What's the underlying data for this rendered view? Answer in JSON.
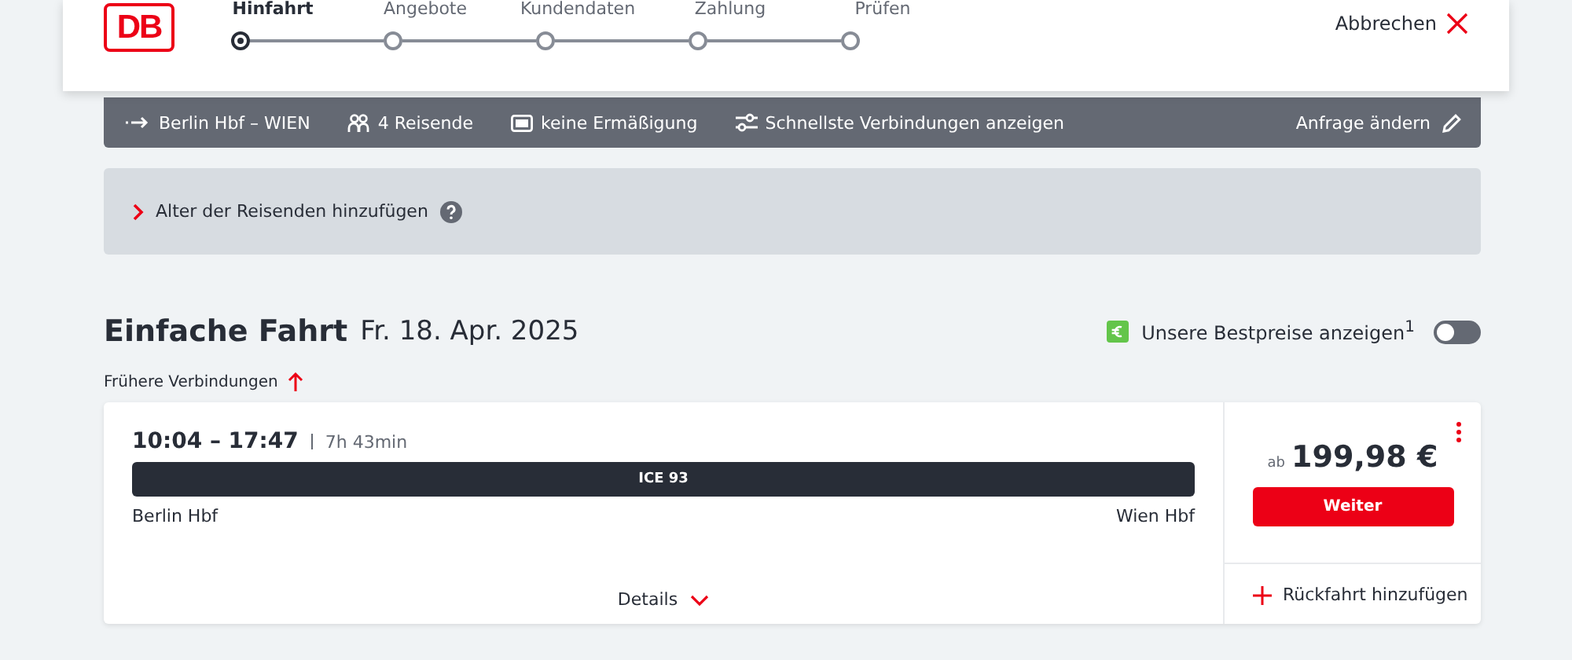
{
  "header": {
    "logo": "DB",
    "cancel": "Abbrechen"
  },
  "steps": [
    {
      "label": "Hinfahrt",
      "selected": true
    },
    {
      "label": "Angebote",
      "selected": false
    },
    {
      "label": "Kundendaten",
      "selected": false
    },
    {
      "label": "Zahlung",
      "selected": false
    },
    {
      "label": "Prüfen",
      "selected": false
    }
  ],
  "summary": {
    "items": [
      {
        "kind": "route",
        "label": "Berlin Hbf – WIEN"
      },
      {
        "kind": "travellers",
        "label": "4 Reisende"
      },
      {
        "kind": "discount",
        "label": "keine Ermäßigung"
      },
      {
        "kind": "filter",
        "label": "Schnellste Verbindungen anzeigen"
      }
    ],
    "edit": "Anfrage ändern"
  },
  "age_panel": {
    "label": "Alter der Reisenden hinzufügen",
    "expanded": false
  },
  "heading": {
    "title": "Einfache Fahrt",
    "date": "Fr. 18. Apr. 2025"
  },
  "best_price": {
    "label": "Unsere Bestpreise anzeigen$^{1}$",
    "on": false
  },
  "earlier": "Frühere Verbindungen",
  "connection": {
    "times": "10:04 – 17:47",
    "duration": "7h 43min",
    "train": "ICE 93",
    "from": "Berlin Hbf",
    "to": "Wien Hbf",
    "details": "Details",
    "price_prefix": "ab",
    "price": "199,98 €",
    "button": "Weiter",
    "return": "Rückfahrt hinzufügen"
  }
}
